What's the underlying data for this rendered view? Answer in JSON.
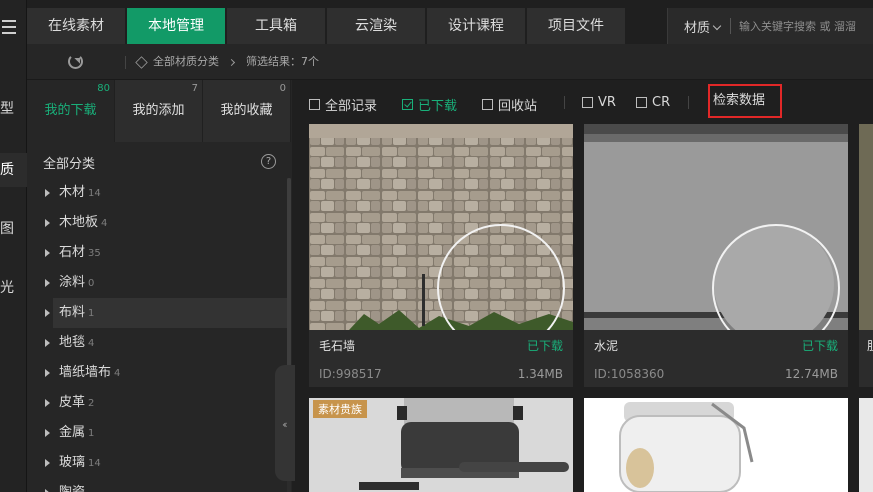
{
  "rail": {
    "items": [
      "型",
      "质",
      "图",
      "光"
    ]
  },
  "topnav": {
    "tabs": [
      "在线素材",
      "本地管理",
      "工具箱",
      "云渲染",
      "设计课程",
      "项目文件"
    ]
  },
  "search": {
    "type": "材质",
    "placeholder": "输入关键字搜索 或 溜溜"
  },
  "crumb": {
    "root": "全部材质分类",
    "result": "筛选结果：7个"
  },
  "subtabs": [
    {
      "label": "我的下载",
      "count": "80"
    },
    {
      "label": "我的添加",
      "count": "7"
    },
    {
      "label": "我的收藏",
      "count": "0"
    }
  ],
  "categories": {
    "title": "全部分类",
    "help": "?",
    "items": [
      {
        "label": "木材",
        "count": "14"
      },
      {
        "label": "木地板",
        "count": "4"
      },
      {
        "label": "石材",
        "count": "35"
      },
      {
        "label": "涂料",
        "count": "0"
      },
      {
        "label": "布料",
        "count": "1"
      },
      {
        "label": "地毯",
        "count": "4"
      },
      {
        "label": "墙纸墙布",
        "count": "4"
      },
      {
        "label": "皮革",
        "count": "2"
      },
      {
        "label": "金属",
        "count": "1"
      },
      {
        "label": "玻璃",
        "count": "14"
      },
      {
        "label": "陶瓷",
        "count": ""
      }
    ]
  },
  "filters": {
    "all_records": "全部记录",
    "downloaded": "已下载",
    "recycle": "回收站",
    "vr": "VR",
    "cr": "CR",
    "search_data": "检索数据"
  },
  "cards": [
    {
      "name": "毛石墙",
      "status": "已下载",
      "id": "ID:998517",
      "size": "1.34MB"
    },
    {
      "name": "水泥",
      "status": "已下载",
      "id": "ID:1058360",
      "size": "12.74MB"
    },
    {
      "name": "胆",
      "status": "",
      "id": "",
      "size": ""
    }
  ],
  "second_row": {
    "badge": "素材贵族"
  },
  "colors": {
    "accent": "#129a67",
    "accent_text": "#19b07a",
    "highlight_box": "#e22828"
  }
}
